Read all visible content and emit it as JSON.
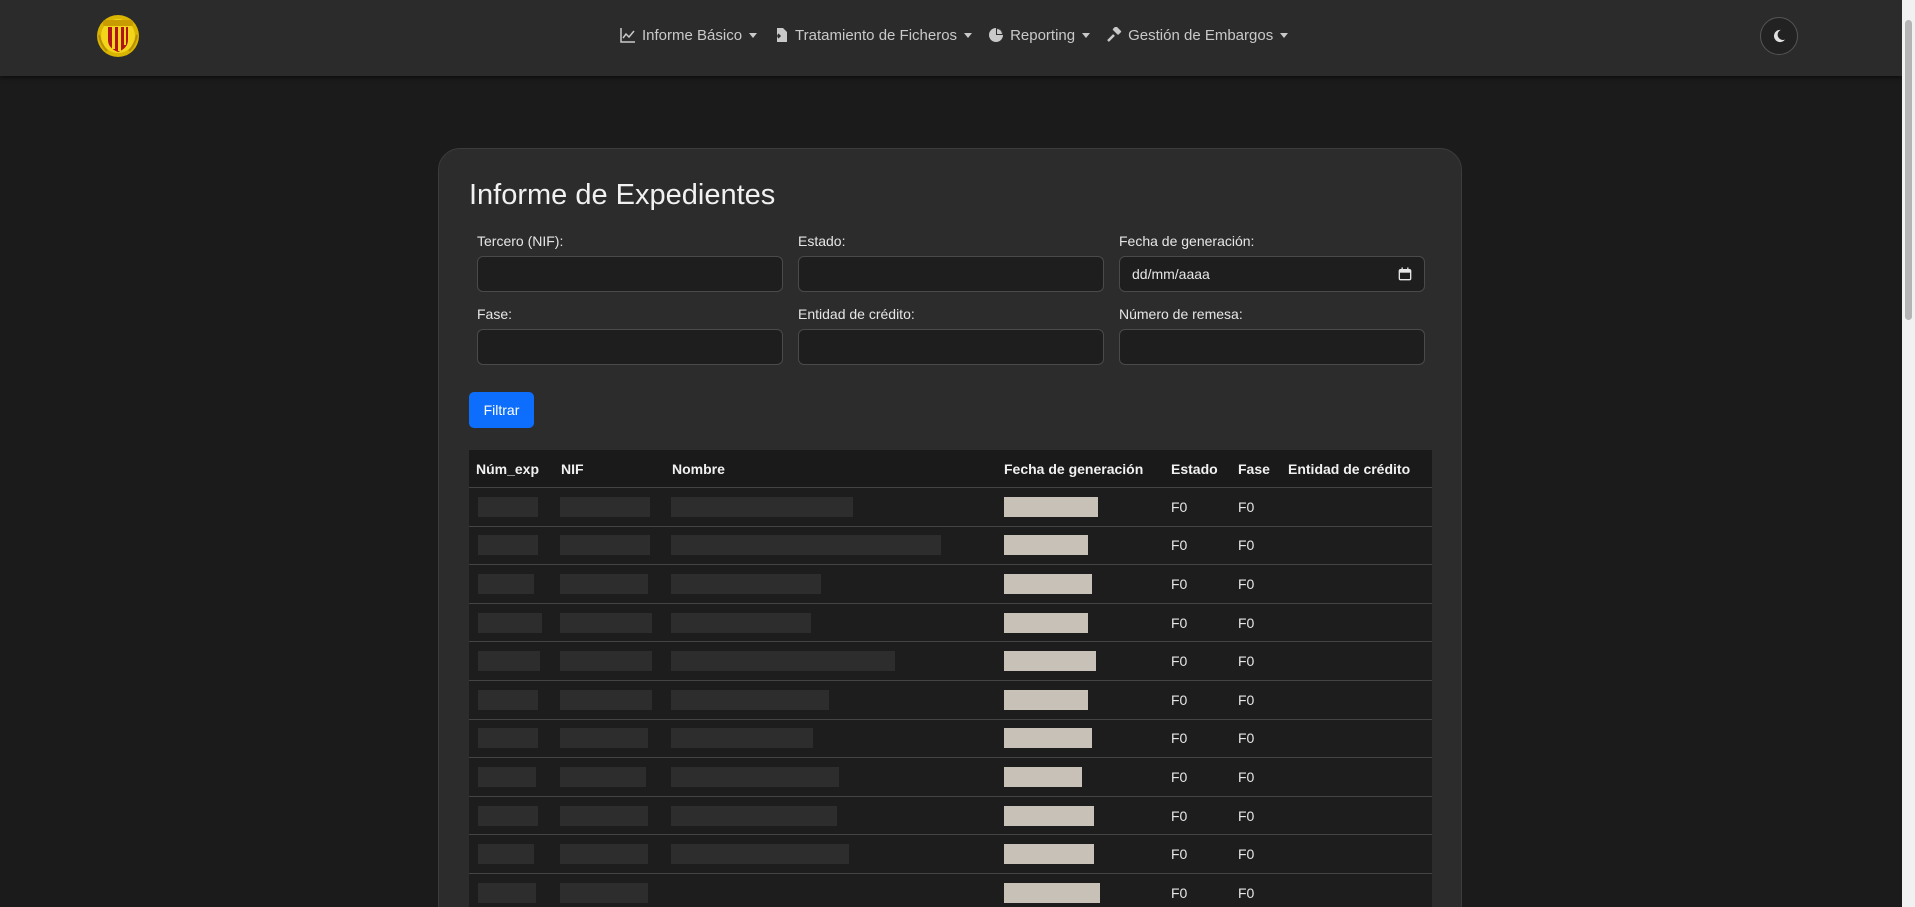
{
  "nav": {
    "items": [
      {
        "label": "Informe Básico",
        "icon": "line-chart-icon"
      },
      {
        "label": "Tratamiento de Ficheros",
        "icon": "file-transfer-icon"
      },
      {
        "label": "Reporting",
        "icon": "pie-chart-icon"
      },
      {
        "label": "Gestión de Embargos",
        "icon": "gavel-icon"
      }
    ],
    "theme_toggle_icon": "moon-icon"
  },
  "page": {
    "title": "Informe de Expedientes"
  },
  "filters": {
    "tercero_label": "Tercero (NIF):",
    "tercero_value": "",
    "estado_label": "Estado:",
    "estado_value": "",
    "fecha_label": "Fecha de generación:",
    "fecha_placeholder": "dd/mm/aaaa",
    "fase_label": "Fase:",
    "fase_value": "",
    "entidad_label": "Entidad de crédito:",
    "entidad_value": "",
    "remesa_label": "Número de remesa:",
    "remesa_value": "",
    "filter_button": "Filtrar"
  },
  "table": {
    "headers": {
      "num_exp": "Núm_exp",
      "nif": "NIF",
      "nombre": "Nombre",
      "fecha": "Fecha de generación",
      "estado": "Estado",
      "fase": "Fase",
      "entidad": "Entidad de crédito"
    },
    "rows": [
      {
        "estado": "F0",
        "fase": "F0"
      },
      {
        "estado": "F0",
        "fase": "F0"
      },
      {
        "estado": "F0",
        "fase": "F0"
      },
      {
        "estado": "F0",
        "fase": "F0"
      },
      {
        "estado": "F0",
        "fase": "F0"
      },
      {
        "estado": "F0",
        "fase": "F0"
      },
      {
        "estado": "F0",
        "fase": "F0"
      },
      {
        "estado": "F0",
        "fase": "F0"
      },
      {
        "estado": "F0",
        "fase": "F0"
      },
      {
        "estado": "F0",
        "fase": "F0"
      },
      {
        "estado": "F0",
        "fase": "F0"
      }
    ]
  },
  "colors": {
    "accent": "#0d6efd",
    "background": "#1b1b1b",
    "card": "#2c2c2c"
  }
}
